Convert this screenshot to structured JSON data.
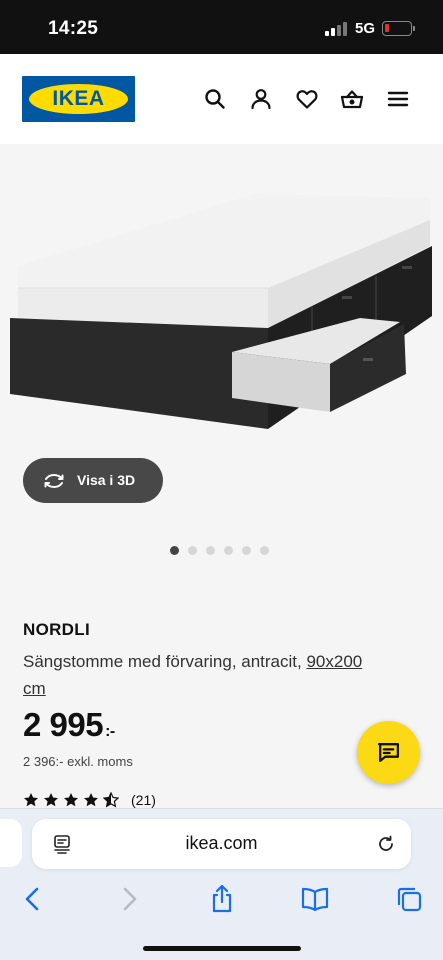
{
  "status": {
    "time": "14:25",
    "network": "5G"
  },
  "header": {
    "logo_text": "IKEA",
    "brand_colors": {
      "blue": "#0058a3",
      "yellow": "#ffdb00"
    },
    "icons": [
      "search-icon",
      "account-icon",
      "heart-icon",
      "basket-icon",
      "menu-icon"
    ]
  },
  "hero": {
    "view3d_label": "Visa i 3D",
    "carousel": {
      "count": 6,
      "active": 1
    }
  },
  "product": {
    "name": "NORDLI",
    "description": "Sängstomme med förvaring, antracit,",
    "size_link": "90x200",
    "size_unit": "cm",
    "price": "2 995",
    "price_suffix": ":-",
    "excl_vat": "2 396:- exkl. moms",
    "rating": 4.5,
    "rating_count": "(21)"
  },
  "browser": {
    "url": "ikea.com",
    "accent": "#1a6ee6"
  }
}
